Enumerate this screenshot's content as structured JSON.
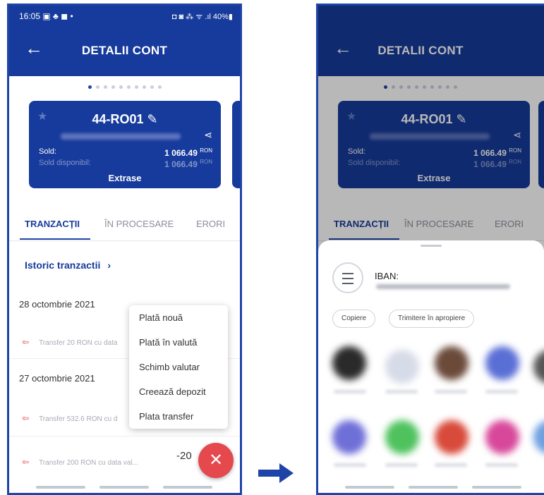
{
  "left": {
    "status": {
      "time": "16:05 ▣ ♣ ◼ •",
      "right": "◘ ◙ ⁂ ᯤ .ıl 40%▮"
    },
    "appbar": {
      "back": "←",
      "title": "DETALII CONT"
    },
    "card": {
      "account": "44-RO01 ✎",
      "sold_label": "Sold:",
      "sold_value": "1 066.49",
      "sold_currency": "RON",
      "available_label": "Sold disponibil:",
      "available_value": "1 066.49",
      "available_currency": "RON",
      "extrase": "Extrase"
    },
    "tabs": [
      "TRANZACȚII",
      "ÎN PROCESARE",
      "ERORI"
    ],
    "history": "Istoric tranzactii",
    "history_chevron": "›",
    "dates": [
      "28 octombrie 2021",
      "27 octombrie 2021"
    ],
    "transactions": [
      "Transfer 20 RON cu data",
      "Transfer 532.6 RON cu d",
      "Transfer 200 RON cu data val..."
    ],
    "amount_partial": "-20",
    "menu": [
      "Plată nouă",
      "Plată în valută",
      "Schimb valutar",
      "Creează depozit",
      "Plata transfer"
    ],
    "fab": "✕"
  },
  "right": {
    "appbar": {
      "back": "←",
      "title": "DETALII CONT"
    },
    "card": {
      "account": "44-RO01 ✎",
      "sold_label": "Sold:",
      "sold_value": "1 066.49",
      "sold_currency": "RON",
      "available_label": "Sold disponibil:",
      "available_value": "1 066.49",
      "available_currency": "RON",
      "extrase": "Extrase"
    },
    "tabs": [
      "TRANZACȚII",
      "ÎN PROCESARE",
      "ERORI"
    ],
    "sheet": {
      "iban_label": "IBAN:",
      "chips": [
        "Copiere",
        "Trimitere în apropiere"
      ]
    }
  },
  "colors": {
    "primary": "#173b9c",
    "accent": "#e5484d"
  },
  "icons": [
    "back-arrow-icon",
    "star-icon",
    "edit-pencil-icon",
    "share-icon",
    "transfer-arrow-icon",
    "close-icon",
    "menu-icon"
  ]
}
